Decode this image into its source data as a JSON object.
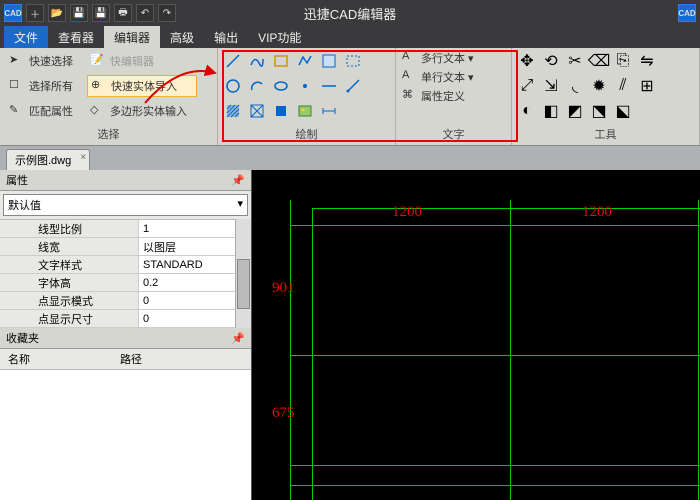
{
  "app": {
    "title": "迅捷CAD编辑器"
  },
  "titlebar_icons": [
    "cad",
    "new",
    "open",
    "save",
    "saveas",
    "print",
    "undo",
    "redo"
  ],
  "menu": {
    "file": "文件",
    "tabs": [
      "查看器",
      "编辑器",
      "高级",
      "输出",
      "VIP功能"
    ],
    "active": 1
  },
  "ribbon": {
    "select": {
      "label": "选择",
      "items": [
        {
          "icon": "quicksel",
          "text": "快速选择"
        },
        {
          "icon": "quickedit",
          "text": "快编辑器",
          "dim": true
        },
        {
          "icon": "selall",
          "text": "选择所有"
        },
        {
          "icon": "import",
          "text": "快速实体导入",
          "hl": true
        },
        {
          "icon": "match",
          "text": "匹配属性"
        },
        {
          "icon": "polyin",
          "text": "多边形实体输入"
        }
      ]
    },
    "draw": {
      "label": "绘制"
    },
    "text": {
      "label": "文字",
      "items": [
        {
          "icon": "mtext",
          "text": "多行文本"
        },
        {
          "icon": "stext",
          "text": "单行文本"
        },
        {
          "icon": "attr",
          "text": "属性定义"
        }
      ]
    },
    "tools": {
      "label": "工具"
    }
  },
  "doc": {
    "name": "示例图.dwg"
  },
  "props": {
    "title": "属性",
    "combo": "默认值",
    "rows": [
      {
        "k": "线型比例",
        "v": "1"
      },
      {
        "k": "线宽",
        "v": "以图层"
      },
      {
        "k": "文字样式",
        "v": "STANDARD"
      },
      {
        "k": "字体高",
        "v": "0.2"
      },
      {
        "k": "点显示模式",
        "v": "0"
      },
      {
        "k": "点显示尺寸",
        "v": "0"
      }
    ]
  },
  "fav": {
    "title": "收藏夹",
    "cols": [
      "名称",
      "路径"
    ]
  },
  "drawing": {
    "dims": {
      "top1": "1200",
      "top2": "1200",
      "left1": "901",
      "left2": "675"
    }
  }
}
